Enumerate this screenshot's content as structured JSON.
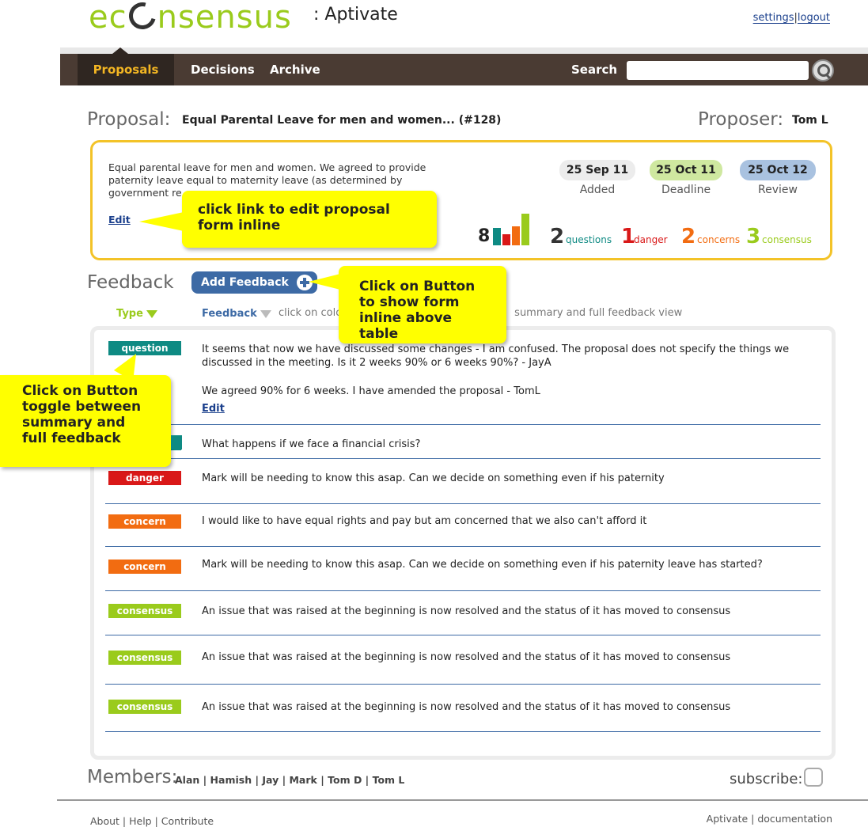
{
  "header": {
    "logo_left": "ec",
    "logo_right": "nsensus",
    "app_name": ": Aptivate",
    "settings_link": "settings",
    "separator": "|",
    "logout_link": "logout"
  },
  "nav": {
    "tabs": [
      "Proposals",
      "Decisions",
      "Archive"
    ],
    "active_tab": "Proposals",
    "search_label": "Search",
    "search_value": ""
  },
  "proposal": {
    "label": "Proposal:",
    "title": "Equal Parental Leave for men and women... (#128)",
    "proposer_label": "Proposer:",
    "proposer_name": "Tom L",
    "text": "Equal parental leave for men and women. We agreed to provide paternity leave equal to maternity leave (as determined by government re",
    "edit_label": "Edit",
    "dates": {
      "added": "25 Sep 11",
      "added_caption": "Added",
      "deadline": "25 Oct 11",
      "deadline_caption": "Deadline",
      "review": "25 Oct 12",
      "review_caption": "Review"
    },
    "total_feedback": "8",
    "stats": [
      {
        "count": "2",
        "label": "questions",
        "color": "#0e8a83"
      },
      {
        "count": "1",
        "label": "danger",
        "color": "#d91818"
      },
      {
        "count": "2",
        "label": "concerns",
        "color": "#f26c11"
      },
      {
        "count": "3",
        "label": "consensus",
        "color": "#9acb1c"
      }
    ]
  },
  "feedback": {
    "label": "Feedback",
    "add_button": "Add Feedback",
    "col_type": "Type",
    "col_feedback": "Feedback",
    "col_hint": "click on colo",
    "col_hint_end": "summary and full feedback view",
    "rows": [
      {
        "type": "question",
        "color": "#0e8a83",
        "text": "It seems that now we have discussed some changes - I am confused. The proposal does not specify the things we discussed in the meeting. Is it 2 weeks 90% or 6 weeks 90%? - JayA",
        "reply": "We agreed 90% for 6 weeks. I have amended the proposal - TomL",
        "edit": "Edit"
      },
      {
        "type": "question",
        "color": "#0e8a83",
        "text": "What happens if we face a financial crisis?"
      },
      {
        "type": "danger",
        "color": "#d91818",
        "text": "Mark will be needing to know this asap. Can we decide on something even if his paternity"
      },
      {
        "type": "concern",
        "color": "#f26c11",
        "text": "I would like to have equal rights and pay but am concerned that we also can't afford it"
      },
      {
        "type": "concern",
        "color": "#f26c11",
        "text": "Mark will be needing to know this asap. Can we decide on something even if his paternity leave has started?"
      },
      {
        "type": "consensus",
        "color": "#9acb1c",
        "text": "An issue that was raised at the beginning is now resolved and the status of it has moved to consensus"
      },
      {
        "type": "consensus",
        "color": "#9acb1c",
        "text": "An issue that was raised at the beginning is now resolved and the status of it has moved to consensus"
      },
      {
        "type": "consensus",
        "color": "#9acb1c",
        "text": "An issue that was raised at the beginning is now resolved and the status of it has moved to consensus"
      }
    ]
  },
  "callouts": {
    "edit_inline": "click link to edit proposal form inline",
    "add_feedback": "Click on Button to show form inline above table",
    "toggle": "Click on Button toggle between summary and full feedback"
  },
  "members": {
    "label": "Members:",
    "list": "Alan | Hamish | Jay | Mark | Tom D | Tom L",
    "subscribe_label": "subscribe:"
  },
  "footer": {
    "left": "About | Help | Contribute",
    "right": "Aptivate | documentation"
  },
  "colors": {
    "brand_green": "#9acb1c",
    "nav_brown": "#4a3b33",
    "active_tab_text": "#f3b623",
    "proposal_border": "#f3c328",
    "button_blue": "#3d6aa5",
    "callout_yellow": "#ffff00"
  }
}
